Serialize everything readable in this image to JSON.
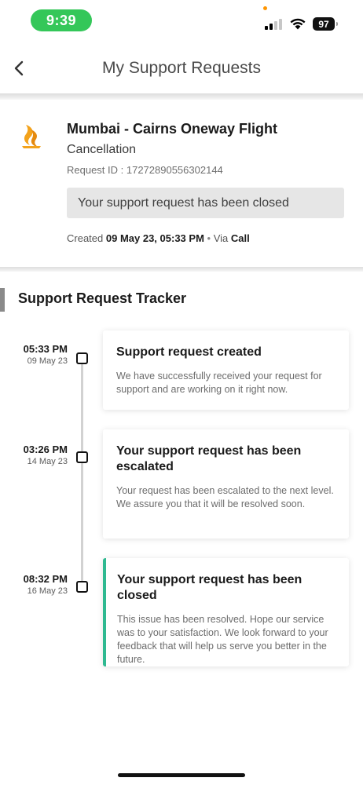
{
  "status_bar": {
    "time": "9:39",
    "battery": "97",
    "icons": [
      "signal-icon",
      "wifi-icon",
      "battery-icon"
    ]
  },
  "header": {
    "title": "My Support Requests",
    "back_icon": "chevron-left-icon"
  },
  "request": {
    "airline_icon": "airline-logo-icon",
    "flight": "Mumbai - Cairns Oneway Flight",
    "category": "Cancellation",
    "request_id": "Request ID : 17272890556302144",
    "status_message": "Your support request has been closed",
    "created_label": "Created",
    "created_value": "09 May 23, 05:33 PM",
    "separator": "•",
    "via_label": "Via",
    "via_value": "Call"
  },
  "tracker": {
    "title": "Support Request Tracker",
    "accent_color": "#2fb991",
    "steps": [
      {
        "time": "05:33 PM",
        "date": "09 May 23",
        "heading": "Support request created",
        "body": "We have successfully received your request for support and are working on it right now."
      },
      {
        "time": "03:26 PM",
        "date": "14 May 23",
        "heading": "Your support request has been escalated",
        "body": "Your request has been escalated to the next level. We assure you that it will be resolved soon."
      },
      {
        "time": "08:32 PM",
        "date": "16 May 23",
        "heading": "Your support request has been closed",
        "body": "This issue has been resolved. Hope our service was to your satisfaction. We look forward to your feedback that will help us serve you better in the future."
      }
    ]
  }
}
